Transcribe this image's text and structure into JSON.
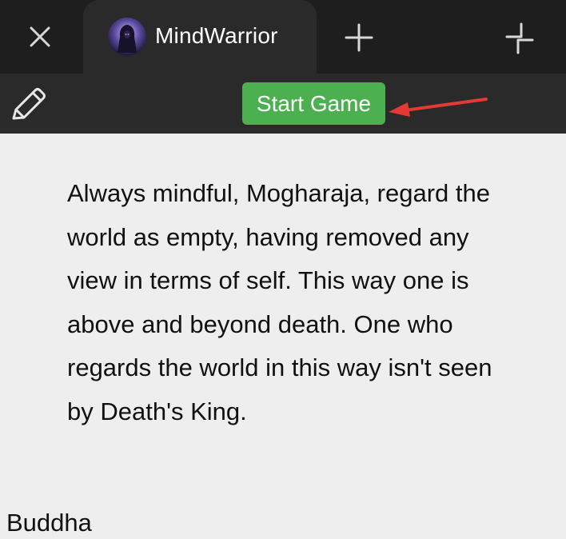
{
  "tabbar": {
    "close_icon": "close-icon",
    "active_tab": {
      "title": "MindWarrior",
      "avatar_icon": "hooded-figure-avatar"
    },
    "new_tab_icon": "plus-icon",
    "expand_icon": "expand-icon"
  },
  "toolbar": {
    "edit_icon": "pencil-icon",
    "start_label": "Start Game",
    "start_color": "#4caf50"
  },
  "annotation": {
    "arrow_color": "#e53935"
  },
  "content": {
    "quote": "Always mindful, Mogharaja, regard the world as empty, having removed any view in terms of self. This way one is above and beyond death. One who regards the world in this way isn't seen by Death's King.",
    "author": "Buddha"
  }
}
